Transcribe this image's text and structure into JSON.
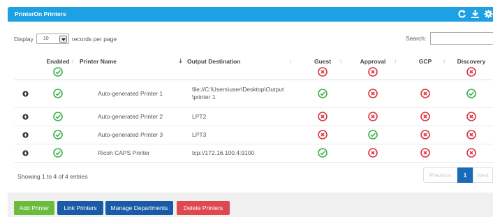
{
  "header": {
    "title": "PrinterOn Printers"
  },
  "toolbar": {
    "display_prefix": "Display",
    "page_length": "10",
    "display_suffix": "records per page",
    "search_label": "Search:",
    "search_value": ""
  },
  "columns": [
    "Enabled",
    "Printer Name",
    "Output Destination",
    "Guest",
    "Approval",
    "GCP",
    "Discovery"
  ],
  "rows": [
    {
      "name": "Auto-generated Printer 1",
      "dest_line1": "file://C:\\Users\\user\\Desktop\\Output",
      "dest_line2": "\\printer 1"
    },
    {
      "name": "Auto-generated Printer 2",
      "dest_line1": "LPT2",
      "dest_line2": ""
    },
    {
      "name": "Auto-generated Printer 3",
      "dest_line1": "LPT3",
      "dest_line2": ""
    },
    {
      "name": "Ricoh CAPS Printer",
      "dest_line1": "tcp://172.16.100.4:9100",
      "dest_line2": ""
    }
  ],
  "info": "Showing 1 to 4 of 4 entries",
  "pager": {
    "prev": "Previous",
    "page": "1",
    "next": "Next"
  },
  "buttons": {
    "add": "Add Printer",
    "link": "Link Printers",
    "dept": "Manage Departments",
    "del": "Delete Printers"
  },
  "colors": {
    "header": "#1da1e2",
    "ok": "#3aae4a",
    "x": "#d8333c",
    "add": "#6bbb3c",
    "blue": "#1a5ba8",
    "del": "#e0484f"
  }
}
